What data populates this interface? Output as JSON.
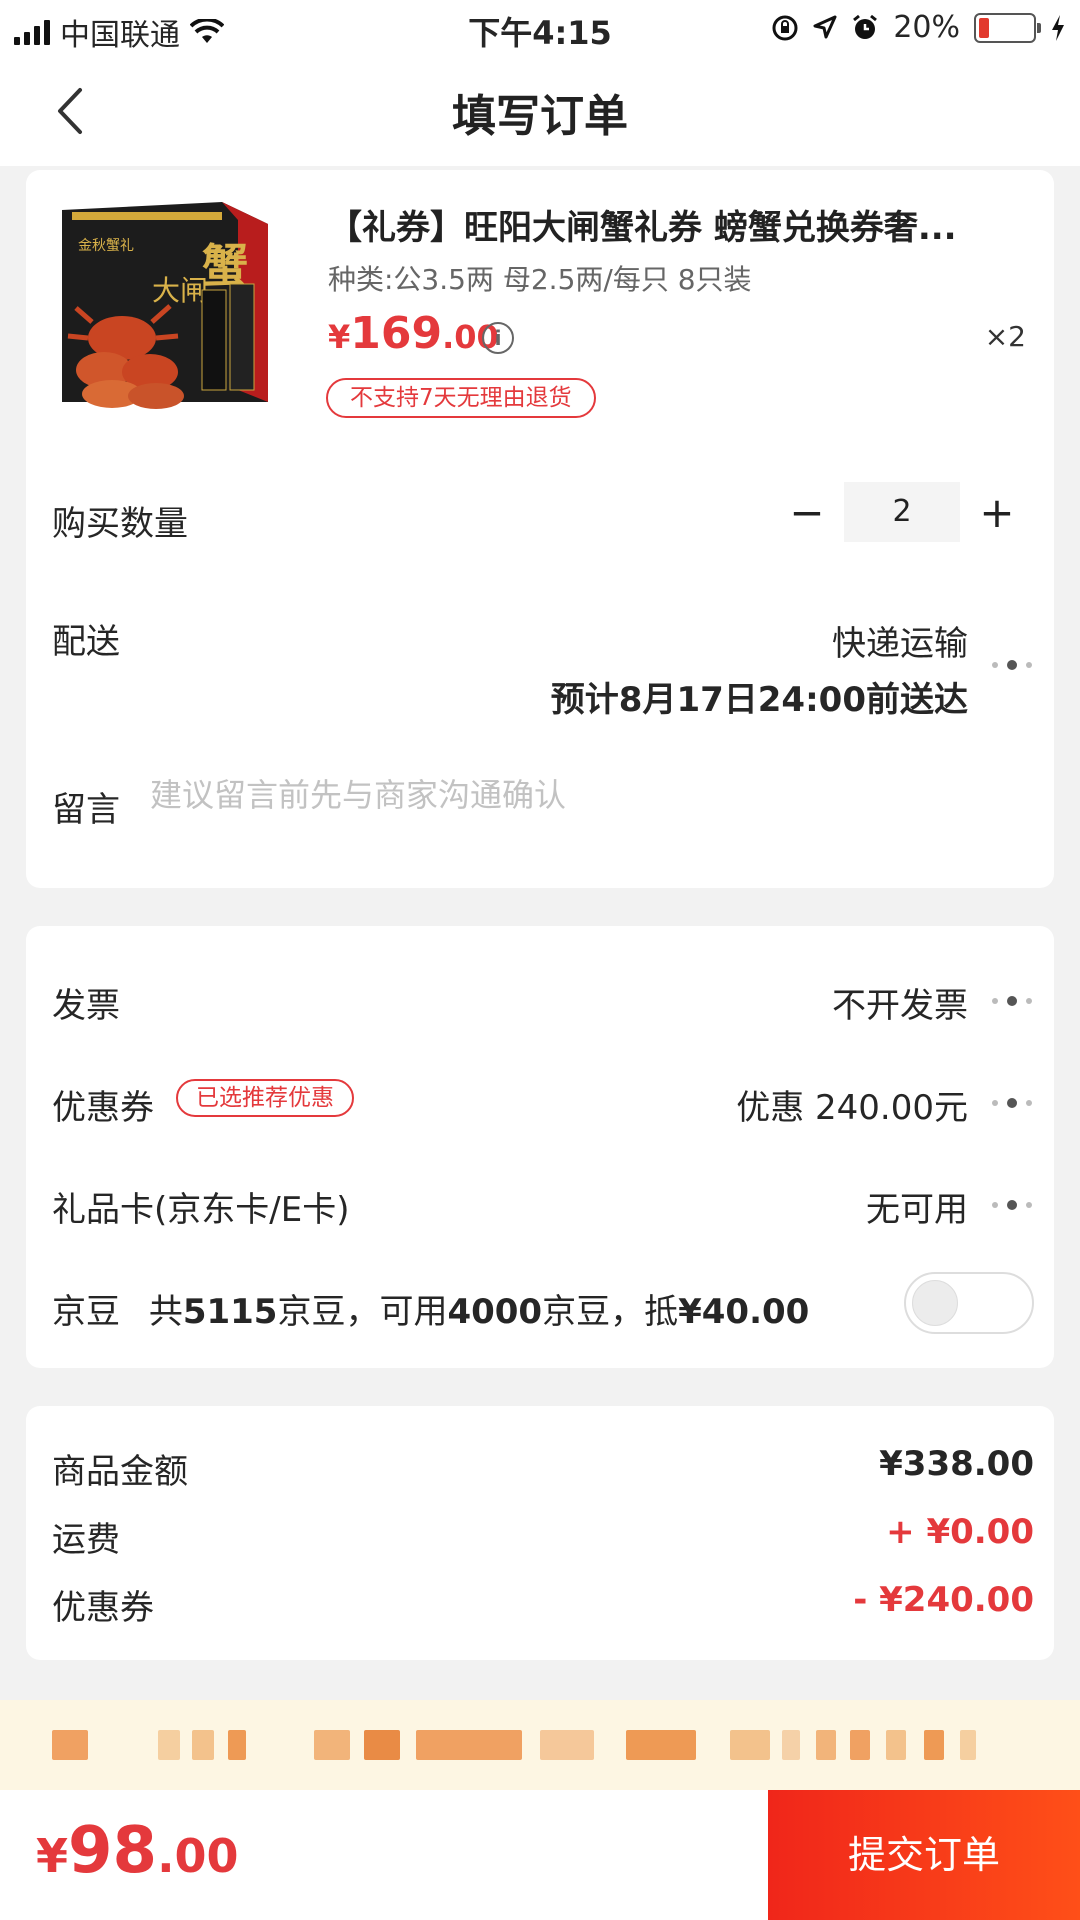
{
  "status_bar": {
    "carrier": "中国联通",
    "time": "下午4:15",
    "battery": "20%",
    "battery_level": 0.2
  },
  "nav": {
    "title": "填写订单",
    "back_icon": "chevron-left-icon"
  },
  "product": {
    "title": "【礼券】旺阳大闸蟹礼券 螃蟹兑换券奢...",
    "spec": "种类:公3.5两 母2.5两/每只 8只装",
    "price_symbol": "¥",
    "price_int": "169",
    "price_dec": ".00",
    "qty": "×2",
    "return_policy": "不支持7天无理由退货"
  },
  "order": {
    "quantity_label": "购买数量",
    "quantity_value": "2",
    "minus": "−",
    "plus": "+",
    "delivery_label": "配送",
    "delivery_method": "快递运输",
    "delivery_estimate": "预计8月17日24:00前送达",
    "message_label": "留言",
    "message_placeholder": "建议留言前先与商家沟通确认"
  },
  "benefits": {
    "invoice_label": "发票",
    "invoice_value": "不开发票",
    "coupon_label": "优惠券",
    "coupon_tag": "已选推荐优惠",
    "coupon_value": "优惠 240.00元",
    "giftcard_label": "礼品卡(京东卡/E卡)",
    "giftcard_value": "无可用",
    "jd_bean_label": "京豆",
    "jd_bean_prefix": "共",
    "jd_bean_total": "5115",
    "jd_bean_mid": "京豆，可用",
    "jd_bean_usable": "4000",
    "jd_bean_mid2": "京豆，抵",
    "jd_bean_offset": "¥40.00",
    "jd_bean_enabled": false
  },
  "summary": {
    "goods_label": "商品金额",
    "goods_value": "¥338.00",
    "shipping_label": "运费",
    "shipping_value": "+ ¥0.00",
    "coupon_label": "优惠券",
    "coupon_value": "- ¥240.00"
  },
  "footer": {
    "total_symbol": "¥",
    "total_int": "98",
    "total_dec": ".00",
    "submit_label": "提交订单"
  },
  "colors": {
    "accent": "#e4393c",
    "submit_gradient_start": "#f0261a",
    "submit_gradient_end": "#ff4f18",
    "banner_bg": "#fdf6e3"
  }
}
